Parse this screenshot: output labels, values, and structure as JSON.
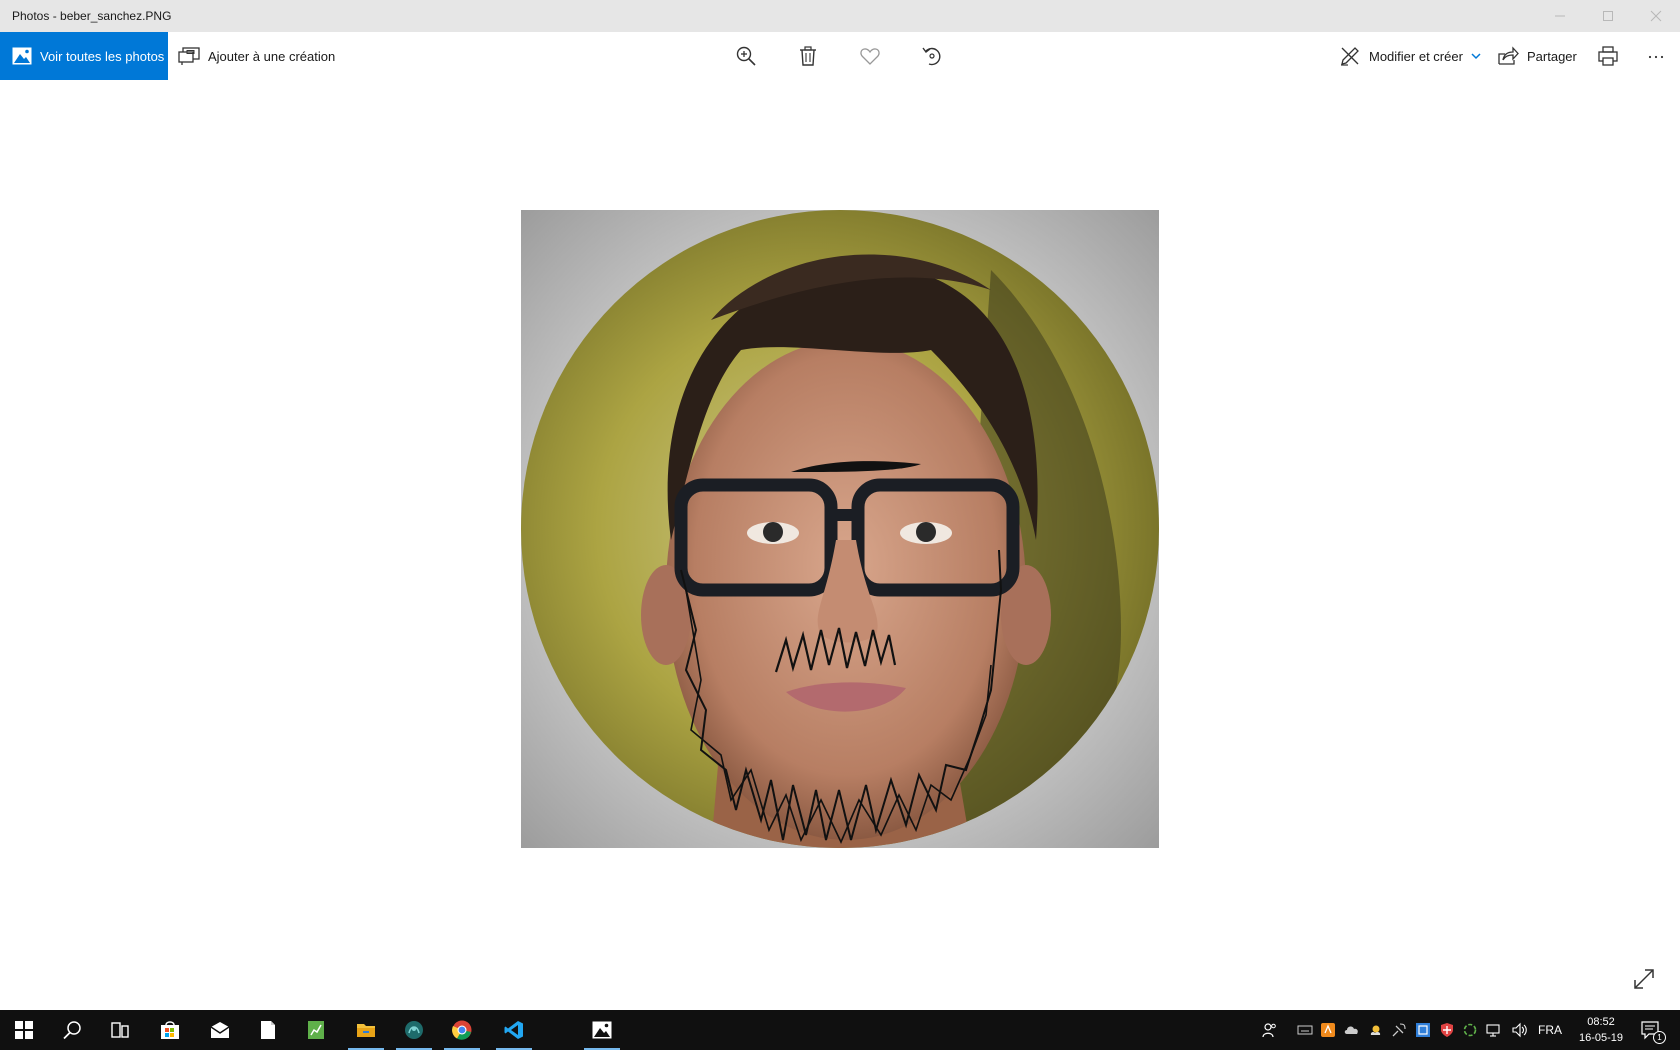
{
  "window": {
    "title": "Photos - beber_sanchez.PNG"
  },
  "toolbar": {
    "view_all_label": "Voir toutes les photos",
    "add_to_creation_label": "Ajouter à une création",
    "zoom_icon": "zoom-in-icon",
    "delete_icon": "trash-icon",
    "favorite_icon": "heart-icon",
    "rotate_icon": "rotate-icon",
    "edit_create_label": "Modifier et créer",
    "share_label": "Partager",
    "print_icon": "printer-icon",
    "more_icon": "ellipsis-icon"
  },
  "photo": {
    "file_name": "beber_sanchez.PNG",
    "background_color": "#b7b246"
  },
  "taskbar": {
    "pinned_apps": [
      "start-icon",
      "search-icon",
      "task-view-icon",
      "store-icon",
      "mail-icon",
      "document-icon",
      "spreadsheet-icon",
      "file-explorer-icon",
      "app-icon",
      "chrome-icon",
      "vscode-icon",
      "photos-icon"
    ],
    "language": "FRA",
    "time": "08:52",
    "date": "16-05-19",
    "notification_count": "1"
  },
  "colors": {
    "accent": "#0078d7",
    "taskbar": "#101010",
    "titlebar": "#e6e6e6"
  }
}
